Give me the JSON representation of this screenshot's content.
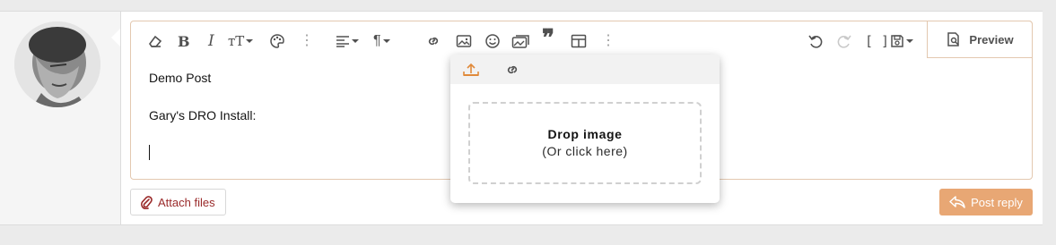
{
  "toolbar": {
    "left_buttons": [
      {
        "name": "eraser-icon"
      },
      {
        "name": "bold-icon"
      },
      {
        "name": "italic-icon"
      },
      {
        "name": "text-size-icon"
      },
      {
        "name": "palette-icon"
      },
      {
        "name": "more-dots-icon"
      },
      {
        "name": "align-icon"
      },
      {
        "name": "paragraph-icon"
      },
      {
        "name": "link-icon"
      },
      {
        "name": "image-icon"
      },
      {
        "name": "smiley-icon"
      },
      {
        "name": "media-gallery-icon"
      },
      {
        "name": "quote-icon"
      },
      {
        "name": "table-icon"
      },
      {
        "name": "more-dots-icon"
      }
    ],
    "right_buttons": [
      {
        "name": "undo-icon"
      },
      {
        "name": "redo-icon"
      },
      {
        "name": "fullscreen-brackets-icon"
      },
      {
        "name": "save-draft-icon"
      }
    ],
    "preview_label": "Preview"
  },
  "content": {
    "line1": "Demo Post",
    "line2": "Gary's DRO Install:"
  },
  "image_popup": {
    "tabs": [
      {
        "name": "upload-icon"
      },
      {
        "name": "link-icon"
      }
    ],
    "drop_title": "Drop image",
    "drop_subtitle": "(Or click here)"
  },
  "footer": {
    "attach_label": "Attach files",
    "post_reply_label": "Post reply"
  },
  "colors": {
    "accent": "#e8a774",
    "border": "#e3c8b0",
    "attach_text": "#9a2a2a"
  }
}
